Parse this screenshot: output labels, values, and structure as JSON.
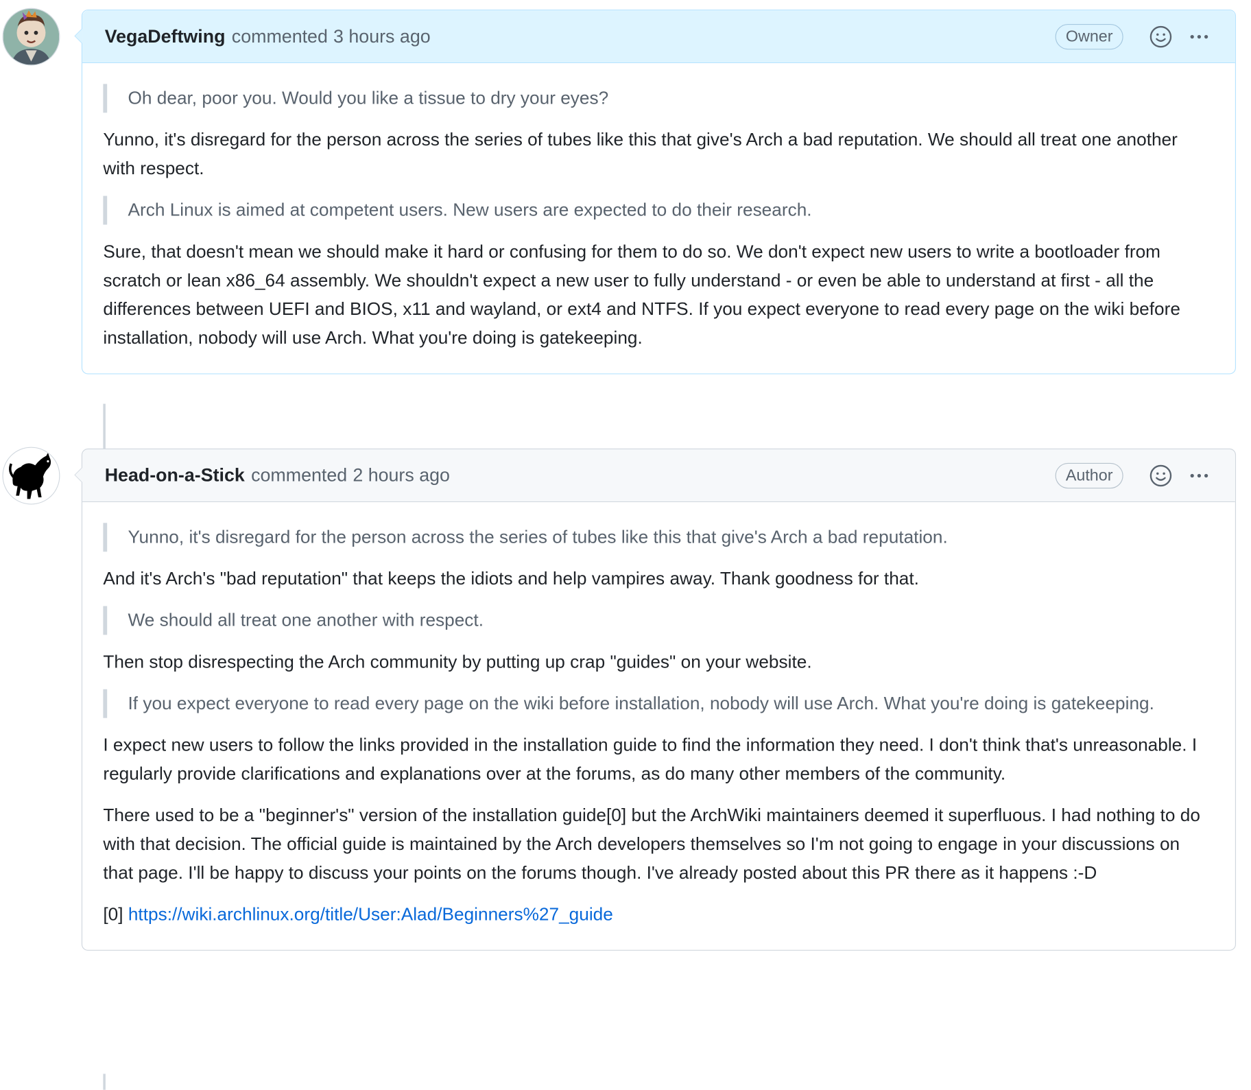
{
  "comments": [
    {
      "author": "VegaDeftwing",
      "action": "commented",
      "time": "3 hours ago",
      "role": "Owner",
      "quote1": "Oh dear, poor you. Would you like a tissue to dry your eyes?",
      "para1": "Yunno, it's disregard for the person across the series of tubes like this that give's Arch a bad reputation. We should all treat one another with respect.",
      "quote2": "Arch Linux is aimed at competent users. New users are expected to do their research.",
      "para2": "Sure, that doesn't mean we should make it hard or confusing for them to do so. We don't expect new users to write a bootloader from scratch or lean x86_64 assembly. We shouldn't expect a new user to fully understand - or even be able to understand at first - all the differences between UEFI and BIOS, x11 and wayland, or ext4 and NTFS. If you expect everyone to read every page on the wiki before installation, nobody will use Arch. What you're doing is gatekeeping."
    },
    {
      "author": "Head-on-a-Stick",
      "action": "commented",
      "time": "2 hours ago",
      "role": "Author",
      "quote1": "Yunno, it's disregard for the person across the series of tubes like this that give's Arch a bad reputation.",
      "para1": "And it's Arch's \"bad reputation\" that keeps the idiots and help vampires away. Thank goodness for that.",
      "quote2": "We should all treat one another with respect.",
      "para2": "Then stop disrespecting the Arch community by putting up crap \"guides\" on your website.",
      "quote3": "If you expect everyone to read every page on the wiki before installation, nobody will use Arch. What you're doing is gatekeeping.",
      "para3": "I expect new users to follow the links provided in the installation guide to find the information they need. I don't think that's unreasonable. I regularly provide clarifications and explanations over at the forums, as do many other members of the community.",
      "para4": "There used to be a \"beginner's\" version of the installation guide[0] but the ArchWiki maintainers deemed it superfluous. I had nothing to do with that decision. The official guide is maintained by the Arch developers themselves so I'm not going to engage in your discussions on that page. I'll be happy to discuss your points on the forums though. I've already posted about this PR there as it happens :-D",
      "ref_prefix": "[0]",
      "ref_link": "https://wiki.archlinux.org/title/User:Alad/Beginners%27_guide"
    }
  ],
  "icons": {
    "reaction": "smiley-icon",
    "menu": "kebab-horizontal-icon"
  },
  "colors": {
    "owner_header_bg": "#ddf4ff",
    "owner_border": "#b6e3ff",
    "author_header_bg": "#f6f8fa",
    "link": "#0969da"
  }
}
